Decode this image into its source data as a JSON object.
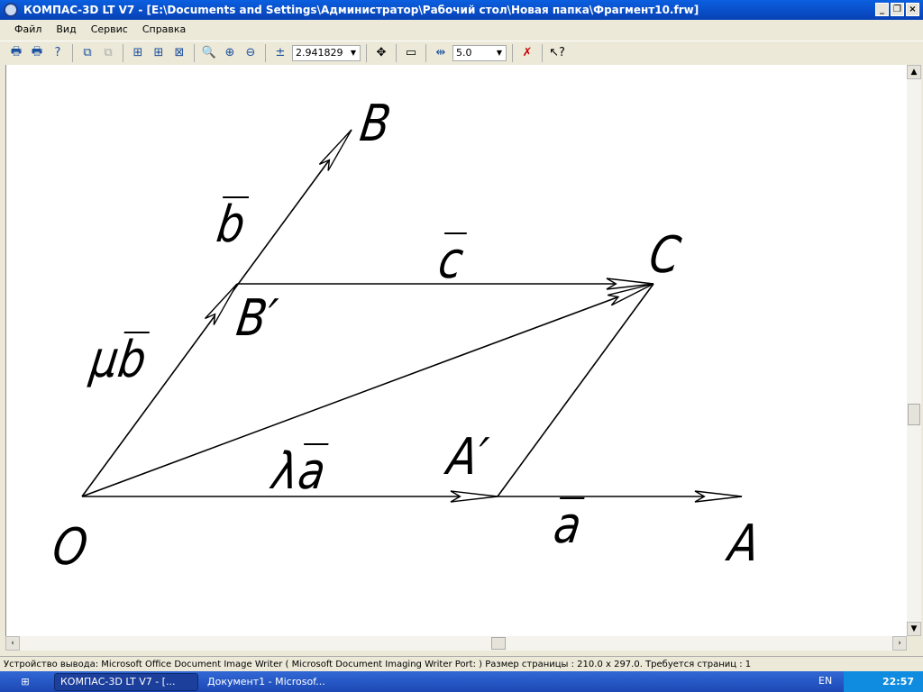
{
  "title": "КОМПАС-3D LT V7 - [E:\\Documents and Settings\\Администратор\\Рабочий стол\\Новая папка\\Фрагмент10.frw]",
  "menu": [
    "Файл",
    "Вид",
    "Сервис",
    "Справка"
  ],
  "toolbar": {
    "zoom_value": "2.941829",
    "step_value": "5.0"
  },
  "drawing": {
    "labels": {
      "B": "B",
      "b": "b",
      "c": "c",
      "C": "C",
      "B_prime": "B′",
      "mu": "μ",
      "mu_b": "b",
      "lambda": "λ",
      "lambda_a": "a",
      "A_prime": "A′",
      "O": "O",
      "a": "a",
      "A": "A"
    }
  },
  "status": "Устройство вывода: Microsoft Office Document Image Writer ( Microsoft Document Imaging Writer Port: )  Размер страницы : 210.0 x 297.0.  Требуется страниц : 1",
  "taskbar": {
    "tasks": [
      "КОМПАС-3D LT V7 - [...",
      "Документ1 - Microsof..."
    ],
    "lang": "EN",
    "clock": "22:57"
  }
}
